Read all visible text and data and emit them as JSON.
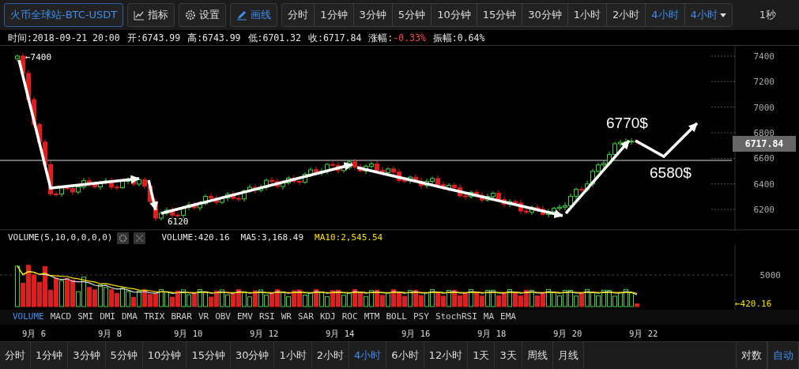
{
  "toolbar": {
    "symbol": "火币全球站-BTC-USDT",
    "tools": [
      {
        "kind": "indicator",
        "label": "指标",
        "active": false
      },
      {
        "kind": "settings",
        "label": "设置",
        "active": false
      },
      {
        "kind": "draw",
        "label": "画线",
        "active": true
      }
    ],
    "periods": [
      {
        "label": "分时",
        "selected": false
      },
      {
        "label": "1分钟",
        "selected": false
      },
      {
        "label": "3分钟",
        "selected": false
      },
      {
        "label": "5分钟",
        "selected": false
      },
      {
        "label": "10分钟",
        "selected": false
      },
      {
        "label": "15分钟",
        "selected": false
      },
      {
        "label": "30分钟",
        "selected": false
      },
      {
        "label": "1小时",
        "selected": false
      },
      {
        "label": "2小时",
        "selected": false
      },
      {
        "label": "4小时",
        "selected": true
      }
    ],
    "period_menu": "4小时",
    "refresh": "1秒"
  },
  "info": [
    {
      "label": "时间:",
      "value": "2018-09-21 20:00",
      "kind": "plain"
    },
    {
      "label": "开:",
      "value": "6743.99",
      "kind": "plain"
    },
    {
      "label": "高:",
      "value": "6743.99",
      "kind": "plain"
    },
    {
      "label": "低:",
      "value": "6701.32",
      "kind": "plain"
    },
    {
      "label": "收:",
      "value": "6717.84",
      "kind": "plain"
    },
    {
      "label": "涨幅:",
      "value": "-0.33%",
      "kind": "down"
    },
    {
      "label": "振幅:",
      "value": "0.64%",
      "kind": "plain"
    }
  ],
  "price_chart": {
    "y_ticks": [
      "7400",
      "7200",
      "7000",
      "6800",
      "6600",
      "6400",
      "6200"
    ],
    "last_price": "6717.84",
    "annotations": [
      {
        "text": "←7400",
        "kind": "small"
      },
      {
        "text": "6120",
        "kind": "small"
      },
      {
        "text": "6770$",
        "kind": "large"
      },
      {
        "text": "6580$",
        "kind": "large"
      }
    ]
  },
  "volume": {
    "title": "VOLUME(5,10,0,0,0,0)",
    "readings": [
      {
        "text": "VOLUME:420.16",
        "kind": "plain"
      },
      {
        "text": "MA5:3,168.49",
        "kind": "plain"
      },
      {
        "text": "MA10:2,545.54",
        "kind": "ma10"
      }
    ],
    "y_tick": "5000",
    "last_volume": "←420.16"
  },
  "indicator_tabs": [
    {
      "label": "VOLUME",
      "selected": true
    },
    {
      "label": "MACD",
      "selected": false
    },
    {
      "label": "SMI",
      "selected": false
    },
    {
      "label": "DMI",
      "selected": false
    },
    {
      "label": "DMA",
      "selected": false
    },
    {
      "label": "TRIX",
      "selected": false
    },
    {
      "label": "BRAR",
      "selected": false
    },
    {
      "label": "VR",
      "selected": false
    },
    {
      "label": "OBV",
      "selected": false
    },
    {
      "label": "EMV",
      "selected": false
    },
    {
      "label": "RSI",
      "selected": false
    },
    {
      "label": "WR",
      "selected": false
    },
    {
      "label": "SAR",
      "selected": false
    },
    {
      "label": "KDJ",
      "selected": false
    },
    {
      "label": "ROC",
      "selected": false
    },
    {
      "label": "MTM",
      "selected": false
    },
    {
      "label": "BOLL",
      "selected": false
    },
    {
      "label": "PSY",
      "selected": false
    },
    {
      "label": "StochRSI",
      "selected": false
    },
    {
      "label": "MA",
      "selected": false
    },
    {
      "label": "EMA",
      "selected": false
    }
  ],
  "x_labels": [
    "9月 6",
    "9月 8",
    "9月 10",
    "9月 12",
    "9月 14",
    "9月 16",
    "9月 18",
    "9月 20",
    "9月 22"
  ],
  "bottom_bar": {
    "periods": [
      {
        "label": "分时",
        "selected": false
      },
      {
        "label": "1分钟",
        "selected": false
      },
      {
        "label": "3分钟",
        "selected": false
      },
      {
        "label": "5分钟",
        "selected": false
      },
      {
        "label": "10分钟",
        "selected": false
      },
      {
        "label": "15分钟",
        "selected": false
      },
      {
        "label": "30分钟",
        "selected": false
      },
      {
        "label": "1小时",
        "selected": false
      },
      {
        "label": "2小时",
        "selected": false
      },
      {
        "label": "4小时",
        "selected": true
      },
      {
        "label": "6小时",
        "selected": false
      },
      {
        "label": "12小时",
        "selected": false
      },
      {
        "label": "1天",
        "selected": false
      },
      {
        "label": "3天",
        "selected": false
      },
      {
        "label": "周线",
        "selected": false
      },
      {
        "label": "月线",
        "selected": false
      }
    ],
    "modes": [
      {
        "label": "对数",
        "selected": false
      },
      {
        "label": "自动",
        "selected": true
      }
    ]
  }
}
